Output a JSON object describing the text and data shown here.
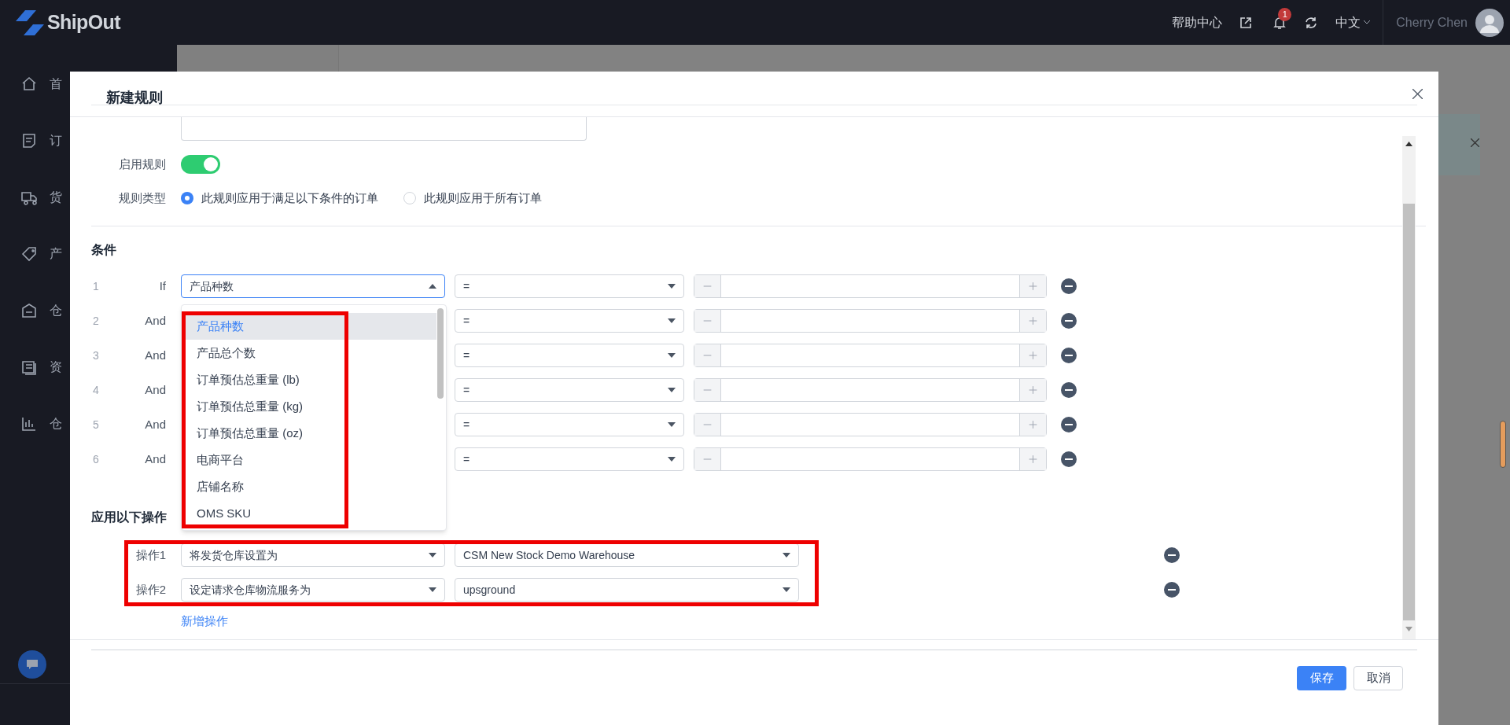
{
  "topbar": {
    "logo": "ShipOut",
    "help": "帮助中心",
    "notifications": "1",
    "language": "中文",
    "user": "Cherry Chen"
  },
  "sidebar": {
    "items": [
      {
        "label": "首"
      },
      {
        "label": "订"
      },
      {
        "label": "货"
      },
      {
        "label": "产"
      },
      {
        "label": "仓"
      },
      {
        "label": "资"
      },
      {
        "label": "仓"
      }
    ]
  },
  "modal": {
    "title": "新建规则",
    "enable": {
      "label": "启用规则",
      "on": true
    },
    "rule_type": {
      "label": "规则类型",
      "options": [
        {
          "label": "此规则应用于满足以下条件的订单",
          "selected": true
        },
        {
          "label": "此规则应用于所有订单",
          "selected": false
        }
      ]
    },
    "conditions_title": "条件",
    "conditions": [
      {
        "number": "1",
        "keyword": "If",
        "field": "产品种数",
        "operator": "="
      },
      {
        "number": "2",
        "keyword": "And",
        "operator": "="
      },
      {
        "number": "3",
        "keyword": "And",
        "operator": "="
      },
      {
        "number": "4",
        "keyword": "And",
        "operator": "="
      },
      {
        "number": "5",
        "keyword": "And",
        "operator": "="
      },
      {
        "number": "6",
        "keyword": "And",
        "operator": "="
      }
    ],
    "field_dropdown_open": true,
    "dropdown": [
      {
        "label": "产品种数",
        "selected": true
      },
      {
        "label": "产品总个数",
        "selected": false
      },
      {
        "label": "订单预估总重量 (lb)",
        "selected": false
      },
      {
        "label": "订单预估总重量 (kg)",
        "selected": false
      },
      {
        "label": "订单预估总重量 (oz)",
        "selected": false
      },
      {
        "label": "电商平台",
        "selected": false
      },
      {
        "label": "店铺名称",
        "selected": false
      },
      {
        "label": "OMS SKU",
        "selected": false
      }
    ],
    "actions_title": "应用以下操作",
    "actions": [
      {
        "label": "操作1",
        "action": "将发货仓库设置为",
        "value": "CSM New Stock Demo Warehouse"
      },
      {
        "label": "操作2",
        "action": "设定请求仓库物流服务为",
        "value": "upsground"
      }
    ],
    "add_action": "新增操作",
    "buttons": {
      "save": "保存",
      "cancel": "取消"
    }
  }
}
